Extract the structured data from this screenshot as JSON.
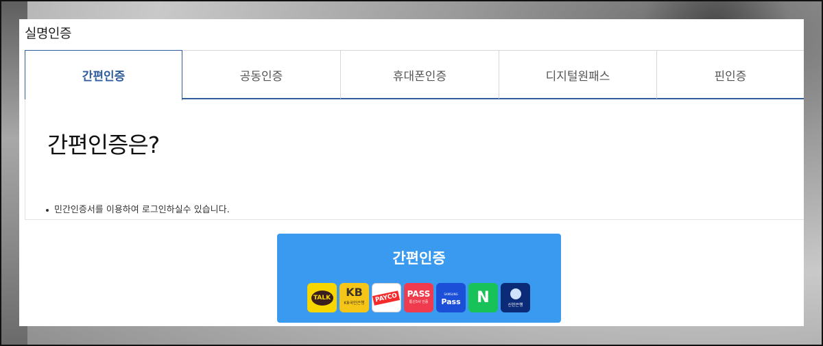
{
  "card": {
    "title": "실명인증"
  },
  "tabs": [
    {
      "label": "간편인증",
      "active": true
    },
    {
      "label": "공동인증",
      "active": false
    },
    {
      "label": "휴대폰인증",
      "active": false
    },
    {
      "label": "디지털원패스",
      "active": false
    },
    {
      "label": "핀인증",
      "active": false
    }
  ],
  "panel": {
    "heading": "간편인증은?",
    "bullet": "민간인증서를 이용하여 로그인하실수 있습니다."
  },
  "auth_button": {
    "label": "간편인증",
    "logos": [
      {
        "name": "kakao-talk-icon",
        "text": "TALK"
      },
      {
        "name": "kb-bank-icon",
        "text": "KB",
        "sub": "KB국민은행"
      },
      {
        "name": "payco-icon",
        "text": "PAYCO"
      },
      {
        "name": "pass-icon",
        "text": "PASS",
        "sub": "통신3사 인증"
      },
      {
        "name": "samsung-pass-icon",
        "text": "Pass",
        "sub": "SAMSUNG"
      },
      {
        "name": "naver-icon",
        "text": "N"
      },
      {
        "name": "shinhan-bank-icon",
        "text": "신한은행"
      }
    ]
  },
  "colors": {
    "accent": "#2f5d9b",
    "button": "#3a9af0"
  }
}
